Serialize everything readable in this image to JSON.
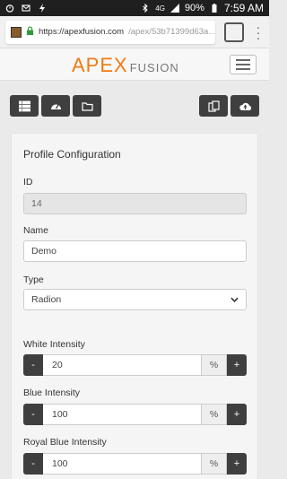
{
  "statusbar": {
    "network": "4G",
    "battery": "90%",
    "time": "7:59 AM"
  },
  "browser": {
    "url_host": "https://apexfusion.com",
    "url_path": "/apex/53b71399d63a…",
    "tabs_count": ""
  },
  "app": {
    "logo_main": "APEX",
    "logo_sub": "FUSION",
    "accent_color": "#f07a12"
  },
  "toolbar": {
    "buttons": [
      {
        "icon": "list-icon"
      },
      {
        "icon": "dashboard-icon"
      },
      {
        "icon": "folder-icon"
      },
      {
        "icon": "copy-icon"
      },
      {
        "icon": "cloud-upload-icon"
      }
    ]
  },
  "profile": {
    "title": "Profile Configuration",
    "id_label": "ID",
    "id_value": "14",
    "name_label": "Name",
    "name_value": "Demo",
    "type_label": "Type",
    "type_value": "Radion",
    "white_label": "White Intensity",
    "white_value": "20",
    "blue_label": "Blue Intensity",
    "blue_value": "100",
    "royal_label": "Royal Blue Intensity",
    "royal_value": "100",
    "unit": "%",
    "minus": "-",
    "plus": "+"
  }
}
